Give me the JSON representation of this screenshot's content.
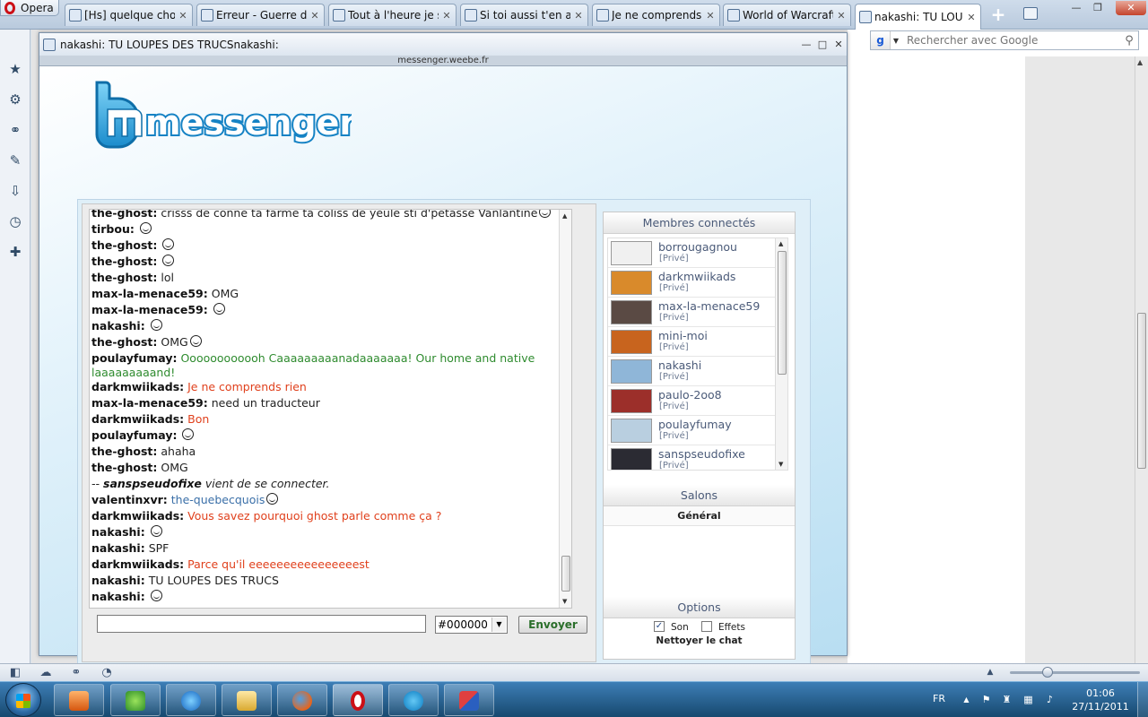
{
  "browser": {
    "menu_label": "Opera",
    "tabs": [
      {
        "title": "[Hs] quelque cho...",
        "active": false
      },
      {
        "title": "Erreur - Guerre de...",
        "active": false
      },
      {
        "title": "Tout à l'heure je s...",
        "active": false
      },
      {
        "title": "Si toi aussi t'en as...",
        "active": false
      },
      {
        "title": "Je ne comprends ...",
        "active": false
      },
      {
        "title": "World of Warcraft...",
        "active": false
      },
      {
        "title": "nakashi: TU LOUP...",
        "active": true
      }
    ],
    "search_placeholder": "Rechercher avec Google",
    "search_engine_icon": "google-icon"
  },
  "popup": {
    "title": "nakashi: TU LOUPES DES TRUCSnakashi:",
    "url": "messenger.weebe.fr",
    "logo_text": "messenger"
  },
  "chat": {
    "messages": [
      {
        "nick": "nakashi:",
        "text": "",
        "smiley": true,
        "color": "#222222"
      },
      {
        "nick": "the-ghost:",
        "text": "crisss de conne ta farme ta coliss de yeule sti d'pétasse Vanlantine",
        "smiley": true,
        "color": "#222222"
      },
      {
        "nick": "tirbou:",
        "text": "",
        "smiley": true,
        "color": "#222222"
      },
      {
        "nick": "the-ghost:",
        "text": "",
        "smiley": true,
        "color": "#222222"
      },
      {
        "nick": "the-ghost:",
        "text": "",
        "smiley": true,
        "color": "#222222"
      },
      {
        "nick": "the-ghost:",
        "text": "lol",
        "smiley": false,
        "color": "#222222"
      },
      {
        "nick": "max-la-menace59:",
        "text": "OMG",
        "smiley": false,
        "color": "#222222"
      },
      {
        "nick": "max-la-menace59:",
        "text": "",
        "smiley": true,
        "color": "#222222"
      },
      {
        "nick": "nakashi:",
        "text": "",
        "smiley": true,
        "color": "#222222"
      },
      {
        "nick": "the-ghost:",
        "text": "OMG",
        "smiley": true,
        "color": "#222222"
      },
      {
        "nick": "poulayfumay:",
        "text": "Oooooooooooh Caaaaaaaaanadaaaaaaa! Our home and native laaaaaaaaand!",
        "smiley": false,
        "color": "#2e8b2e"
      },
      {
        "nick": "darkmwiikads:",
        "text": "Je ne comprends rien",
        "smiley": false,
        "color": "#e0401c"
      },
      {
        "nick": "max-la-menace59:",
        "text": "need un traducteur",
        "smiley": false,
        "color": "#222222"
      },
      {
        "nick": "darkmwiikads:",
        "text": "Bon",
        "smiley": false,
        "color": "#e0401c"
      },
      {
        "nick": "poulayfumay:",
        "text": "",
        "smiley": true,
        "color": "#222222"
      },
      {
        "nick": "the-ghost:",
        "text": "ahaha",
        "smiley": false,
        "color": "#222222"
      },
      {
        "nick": "the-ghost:",
        "text": "OMG",
        "smiley": false,
        "color": "#222222"
      },
      {
        "system": true,
        "prefix": "--",
        "nick": "sanspseudofixe",
        "text": "vient de se connecter."
      },
      {
        "nick": "valentinxvr:",
        "text": "the-quebecquois",
        "smiley": true,
        "color": "#3a6fa8"
      },
      {
        "nick": "darkmwiikads:",
        "text": "Vous savez pourquoi ghost parle comme ça ?",
        "smiley": false,
        "color": "#e0401c"
      },
      {
        "nick": "nakashi:",
        "text": "",
        "smiley": true,
        "color": "#222222"
      },
      {
        "nick": "nakashi:",
        "text": "SPF",
        "smiley": false,
        "color": "#222222"
      },
      {
        "nick": "darkmwiikads:",
        "text": "Parce qu'il eeeeeeeeeeeeeeeest",
        "smiley": false,
        "color": "#e0401c"
      },
      {
        "nick": "nakashi:",
        "text": "TU LOUPES DES TRUCS",
        "smiley": false,
        "color": "#222222"
      },
      {
        "nick": "nakashi:",
        "text": "",
        "smiley": true,
        "color": "#222222"
      }
    ],
    "input_value": "",
    "color_value": "#000000",
    "send_label": "Envoyer"
  },
  "sidebar": {
    "members_title": "Membres connectés",
    "members": [
      {
        "name": "borrougagnou",
        "tag": "[Privé]",
        "avatar_color": "#f0f0f0"
      },
      {
        "name": "darkmwiikads",
        "tag": "[Privé]",
        "avatar_color": "#d98a2b"
      },
      {
        "name": "max-la-menace59",
        "tag": "[Privé]",
        "avatar_color": "#5a4a44"
      },
      {
        "name": "mini-moi",
        "tag": "[Privé]",
        "avatar_color": "#c8641e"
      },
      {
        "name": "nakashi",
        "tag": "[Privé]",
        "avatar_color": "#8fb6d8"
      },
      {
        "name": "paulo-2oo8",
        "tag": "[Privé]",
        "avatar_color": "#9c2f2a"
      },
      {
        "name": "poulayfumay",
        "tag": "[Privé]",
        "avatar_color": "#b9cfe0"
      },
      {
        "name": "sanspseudofixe",
        "tag": "[Privé]",
        "avatar_color": "#2b2b33"
      }
    ],
    "rooms_title": "Salons",
    "room_general": "Général",
    "options_title": "Options",
    "opt_sound": "Son",
    "opt_sound_checked": true,
    "opt_effects": "Effets",
    "opt_effects_checked": false,
    "clear_chat": "Nettoyer le chat"
  },
  "taskbar": {
    "lang": "FR",
    "time": "01:06",
    "date": "27/11/2011"
  },
  "colors": {
    "accent": "#1f8fd0",
    "chat_green": "#2e8b2e",
    "chat_red": "#e0401c",
    "chat_blue": "#3a6fa8"
  }
}
